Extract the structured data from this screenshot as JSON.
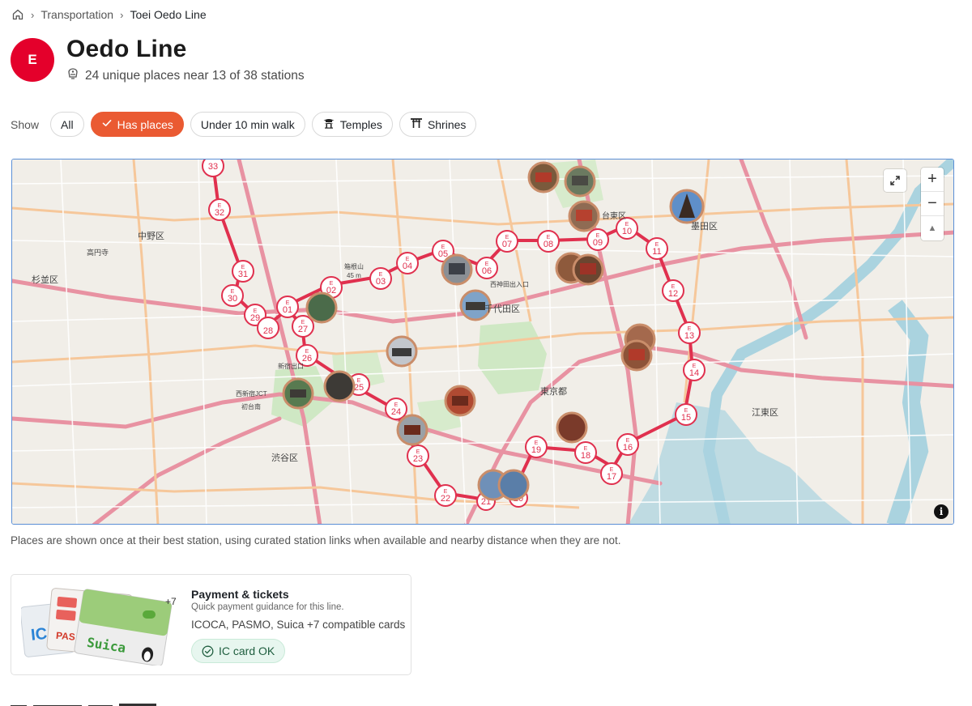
{
  "breadcrumb": {
    "parent": "Transportation",
    "current": "Toei Oedo Line"
  },
  "header": {
    "badge": "E",
    "title": "Oedo Line",
    "subtitle": "24 unique places near 13 of 38 stations"
  },
  "filters": {
    "show_label": "Show",
    "chips": [
      {
        "label": "All",
        "active": false
      },
      {
        "label": "Has places",
        "active": true
      },
      {
        "label": "Under 10 min walk",
        "active": false
      },
      {
        "label": "Temples",
        "active": false
      },
      {
        "label": "Shrines",
        "active": false
      }
    ]
  },
  "map": {
    "line_color": "#e0304e",
    "stations": [
      {
        "id": "33"
      },
      {
        "id": "32"
      },
      {
        "id": "31"
      },
      {
        "id": "30"
      },
      {
        "id": "29"
      },
      {
        "id": "28"
      },
      {
        "id": "27"
      },
      {
        "id": "26"
      },
      {
        "id": "25"
      },
      {
        "id": "24"
      },
      {
        "id": "23"
      },
      {
        "id": "22"
      },
      {
        "id": "21"
      },
      {
        "id": "20"
      },
      {
        "id": "19"
      },
      {
        "id": "18"
      },
      {
        "id": "17"
      },
      {
        "id": "16"
      },
      {
        "id": "15"
      },
      {
        "id": "14"
      },
      {
        "id": "13"
      },
      {
        "id": "12"
      },
      {
        "id": "11"
      },
      {
        "id": "10"
      },
      {
        "id": "09"
      },
      {
        "id": "08"
      },
      {
        "id": "07"
      },
      {
        "id": "06"
      },
      {
        "id": "05"
      },
      {
        "id": "04"
      },
      {
        "id": "03"
      },
      {
        "id": "02"
      },
      {
        "id": "01"
      }
    ],
    "labels": [
      "中野区",
      "杉並区",
      "高円寺",
      "渋谷区",
      "千代田区",
      "東京都",
      "台東区",
      "墨田区",
      "江東区",
      "西新宿JCT",
      "初台南",
      "新宿出口",
      "西神田出入口",
      "箱根山",
      "45 m"
    ],
    "zoom_in": "+",
    "zoom_out": "−",
    "compass": "▲",
    "info": "i"
  },
  "map_note": "Places are shown once at their best station, using curated station links when available and nearby distance when they are not.",
  "payment": {
    "more_count": "+7",
    "title": "Payment & tickets",
    "description": "Quick payment guidance for this line.",
    "cards": "ICOCA, PASMO, Suica +7 compatible cards",
    "badge": "IC card OK"
  }
}
